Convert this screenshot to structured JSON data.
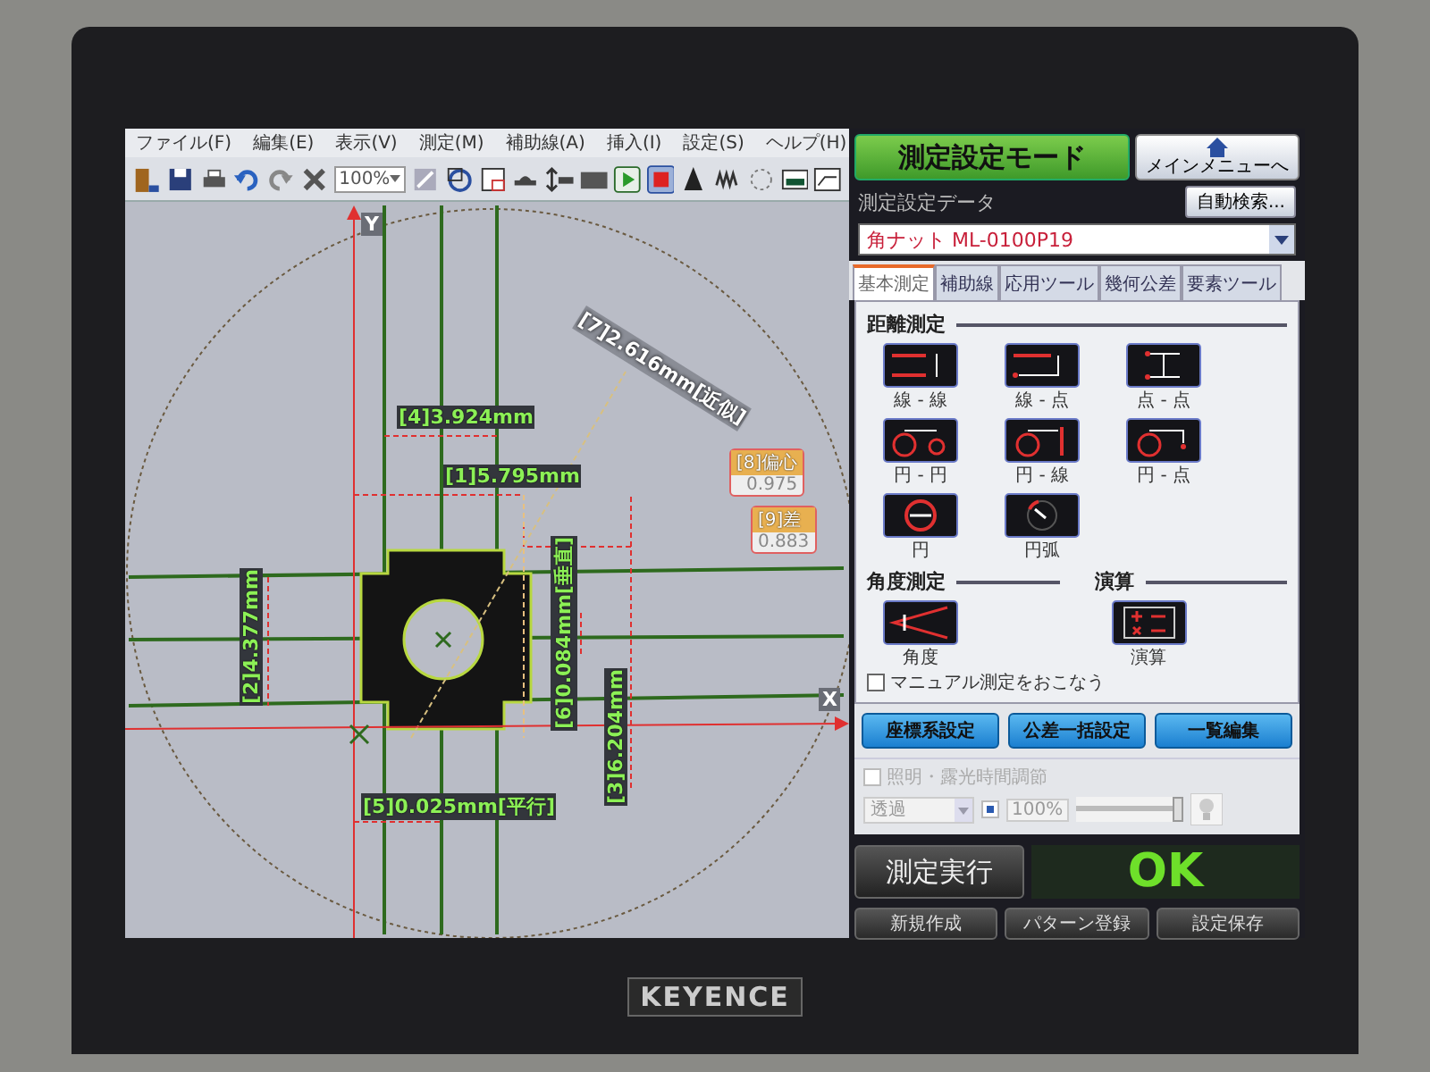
{
  "menu_bar": [
    "ファイル(F)",
    "編集(E)",
    "表示(V)",
    "測定(M)",
    "補助線(A)",
    "挿入(I)",
    "設定(S)",
    "ヘルプ(H)"
  ],
  "toolbar": {
    "zoom": "100%"
  },
  "canvas": {
    "axes": [
      {
        "kind": "y",
        "label": "Y"
      },
      {
        "kind": "x",
        "label": "X"
      }
    ],
    "measurements": [
      {
        "kind": "diagonal",
        "text": "[7]2.616mm[近似]"
      },
      {
        "kind": "horizontal",
        "text": "[4]3.924mm"
      },
      {
        "kind": "horizontal",
        "text": "[1]5.795mm"
      },
      {
        "kind": "vertical",
        "text": "[2]4.377mm"
      },
      {
        "kind": "vertical",
        "text": "[6]0.084mm[垂直]"
      },
      {
        "kind": "vertical",
        "text": "[3]6.204mm"
      },
      {
        "kind": "horizontal",
        "text": "[5]0.025mm[平行]"
      }
    ],
    "results": [
      {
        "label": "[8]偏心",
        "value": "0.975"
      },
      {
        "label": "[9]差",
        "value": "0.883"
      }
    ]
  },
  "panel": {
    "mode": "測定設定モード",
    "main_menu": "メインメニューへ",
    "data_label": "測定設定データ",
    "auto_search": "自動検索...",
    "data_select": "角ナット ML-0100P19",
    "tabs": [
      {
        "label": "基本測定",
        "selected": true
      },
      {
        "label": "補助線",
        "selected": false
      },
      {
        "label": "応用ツール",
        "selected": false
      },
      {
        "label": "幾何公差",
        "selected": false
      },
      {
        "label": "要素ツール",
        "selected": false
      }
    ],
    "sections": [
      {
        "title": "距離測定",
        "tools": [
          {
            "kind": "line-line",
            "label": "線 - 線"
          },
          {
            "kind": "line-point",
            "label": "線 - 点"
          },
          {
            "kind": "point-point",
            "label": "点 - 点"
          },
          {
            "kind": "circle-circle",
            "label": "円 - 円"
          },
          {
            "kind": "circle-line",
            "label": "円 - 線"
          },
          {
            "kind": "circle-point",
            "label": "円 - 点"
          },
          {
            "kind": "circle",
            "label": "円"
          },
          {
            "kind": "arc",
            "label": "円弧"
          }
        ]
      },
      {
        "title": "角度測定",
        "tools": [
          {
            "kind": "angle",
            "label": "角度"
          }
        ]
      },
      {
        "title": "演算",
        "tools": [
          {
            "kind": "calc",
            "label": "演算"
          }
        ]
      }
    ],
    "manual": {
      "label": "マニュアル測定をおこなう",
      "checked": false
    },
    "actions": [
      "座標系設定",
      "公差一括設定",
      "一覧編集"
    ],
    "lighting": {
      "label": "照明・露光時間調節",
      "checked": false,
      "disabled": true,
      "mode": "透過",
      "auto_checked": true,
      "percent": "100%",
      "level": 0.95
    },
    "run": "測定実行",
    "result": {
      "text": "OK"
    },
    "footer": [
      "新規作成",
      "パターン登録",
      "設定保存"
    ]
  },
  "monitor": {
    "logo": "KEYENCE"
  }
}
